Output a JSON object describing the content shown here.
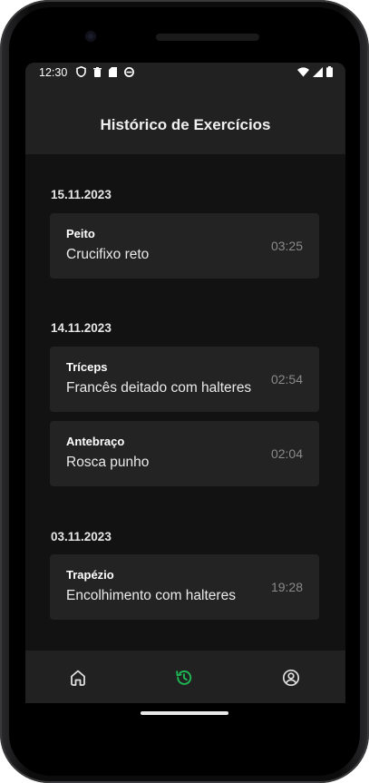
{
  "status_bar": {
    "time": "12:30"
  },
  "header": {
    "title": "Histórico de Exercícios"
  },
  "history": [
    {
      "date": "15.11.2023",
      "entries": [
        {
          "group": "Peito",
          "exercise": "Crucifixo reto",
          "duration": "03:25"
        }
      ]
    },
    {
      "date": "14.11.2023",
      "entries": [
        {
          "group": "Tríceps",
          "exercise": "Francês deitado com halteres",
          "duration": "02:54"
        },
        {
          "group": "Antebraço",
          "exercise": "Rosca punho",
          "duration": "02:04"
        }
      ]
    },
    {
      "date": "03.11.2023",
      "entries": [
        {
          "group": "Trapézio",
          "exercise": "Encolhimento com halteres",
          "duration": "19:28"
        }
      ]
    }
  ],
  "nav": {
    "items": [
      {
        "icon": "home-icon",
        "active": false
      },
      {
        "icon": "history-icon",
        "active": true
      },
      {
        "icon": "profile-icon",
        "active": false
      }
    ],
    "active_color": "#1db954",
    "inactive_color": "#e0e0e0"
  },
  "colors": {
    "background": "#121212",
    "surface": "#212121",
    "card": "#232323"
  }
}
